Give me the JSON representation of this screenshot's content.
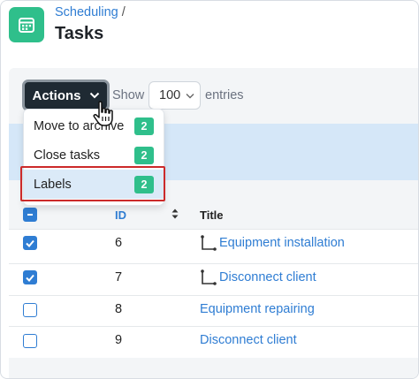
{
  "header": {
    "breadcrumb": "Scheduling",
    "breadcrumb_separator": "/",
    "title": "Tasks",
    "icon": "calendar-icon",
    "accent_color": "#2fbf8b"
  },
  "toolbar": {
    "actions_label": "Actions",
    "show_label": "Show",
    "entries_value": "100",
    "entries_label": "entries"
  },
  "actions_menu": {
    "items": [
      {
        "label": "Move to archive",
        "count": "2"
      },
      {
        "label": "Close tasks",
        "count": "2"
      },
      {
        "label": "Labels",
        "count": "2",
        "highlighted": true
      }
    ]
  },
  "table": {
    "columns": [
      "ID",
      "Title"
    ],
    "rows": [
      {
        "checked": true,
        "id": "6",
        "title": "Equipment installation",
        "subtask": true
      },
      {
        "checked": true,
        "id": "7",
        "title": "Disconnect client",
        "subtask": true
      },
      {
        "checked": false,
        "id": "8",
        "title": "Equipment repairing",
        "subtask": false
      },
      {
        "checked": false,
        "id": "9",
        "title": "Disconnect client",
        "subtask": false
      }
    ]
  },
  "colors": {
    "link": "#2f7dd3",
    "badge": "#2fbf8b",
    "highlight_border": "#cc2a2a",
    "selected_row_band": "#d5e7f8"
  }
}
